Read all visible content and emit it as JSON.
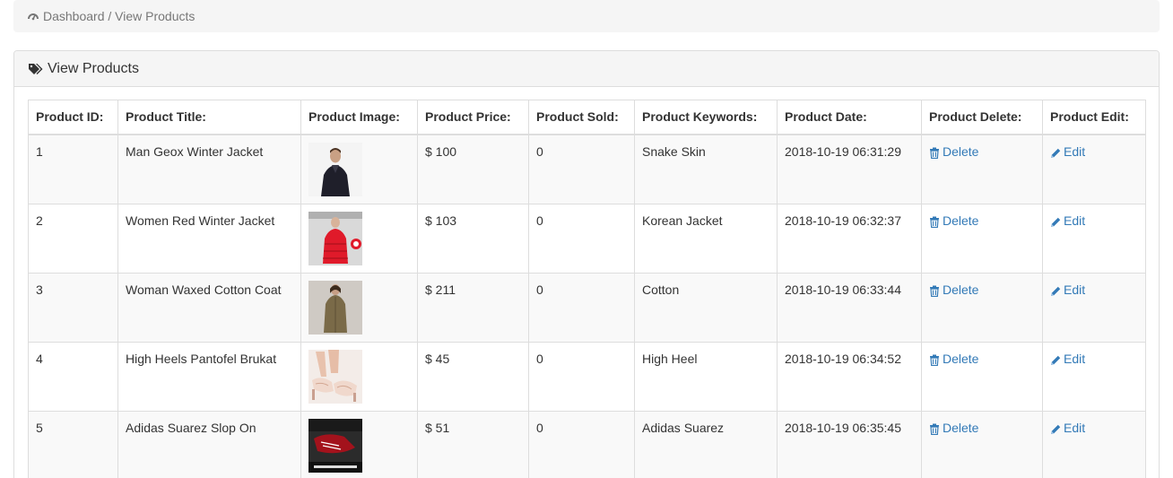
{
  "breadcrumb": {
    "icon": "dashboard-icon",
    "text": "Dashboard / View Products"
  },
  "panel": {
    "icon": "tags-icon",
    "title": "View Products"
  },
  "table": {
    "headers": [
      "Product ID:",
      "Product Title:",
      "Product Image:",
      "Product Price:",
      "Product Sold:",
      "Product Keywords:",
      "Product Date:",
      "Product Delete:",
      "Product Edit:"
    ],
    "rows": [
      {
        "id": "1",
        "title": "Man Geox Winter Jacket",
        "image": "man-in-black-jacket-photo",
        "price": "$ 100",
        "sold": "0",
        "keywords": "Snake Skin",
        "date": "2018-10-19 06:31:29",
        "delete": "Delete",
        "edit": "Edit"
      },
      {
        "id": "2",
        "title": "Women Red Winter Jacket",
        "image": "woman-in-red-jacket-photo",
        "price": "$ 103",
        "sold": "0",
        "keywords": "Korean Jacket",
        "date": "2018-10-19 06:32:37",
        "delete": "Delete",
        "edit": "Edit"
      },
      {
        "id": "3",
        "title": "Woman Waxed Cotton Coat",
        "image": "woman-in-olive-coat-photo",
        "price": "$ 211",
        "sold": "0",
        "keywords": "Cotton",
        "date": "2018-10-19 06:33:44",
        "delete": "Delete",
        "edit": "Edit"
      },
      {
        "id": "4",
        "title": "High Heels Pantofel Brukat",
        "image": "lace-high-heels-photo",
        "price": "$ 45",
        "sold": "0",
        "keywords": "High Heel",
        "date": "2018-10-19 06:34:52",
        "delete": "Delete",
        "edit": "Edit"
      },
      {
        "id": "5",
        "title": "Adidas Suarez Slop On",
        "image": "adidas-slide-sandal-photo",
        "price": "$ 51",
        "sold": "0",
        "keywords": "Adidas Suarez",
        "date": "2018-10-19 06:35:45",
        "delete": "Delete",
        "edit": "Edit"
      }
    ]
  },
  "colors": {
    "link": "#337ab7",
    "border": "#dddddd",
    "stripe": "#f9f9f9",
    "heading_bg": "#f5f5f5"
  }
}
